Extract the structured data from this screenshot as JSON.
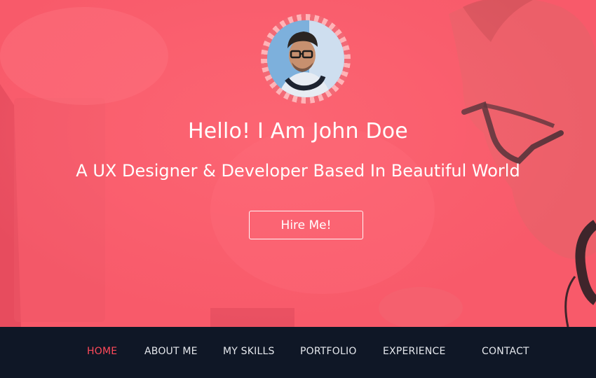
{
  "hero": {
    "greeting": "Hello! I Am John Doe",
    "tagline": "A UX Designer & Developer Based In Beautiful World",
    "cta_label": "Hire Me!",
    "overlay_color": "#f85a6a"
  },
  "nav": {
    "items": [
      {
        "label": "HOME",
        "active": true
      },
      {
        "label": "ABOUT ME",
        "active": false
      },
      {
        "label": "MY SKILLS",
        "active": false
      },
      {
        "label": "PORTFOLIO",
        "active": false
      },
      {
        "label": "EXPERIENCE",
        "active": false
      },
      {
        "label": "CONTACT",
        "active": false
      }
    ],
    "background": "#0f1726",
    "active_color": "#ff4a5a"
  }
}
